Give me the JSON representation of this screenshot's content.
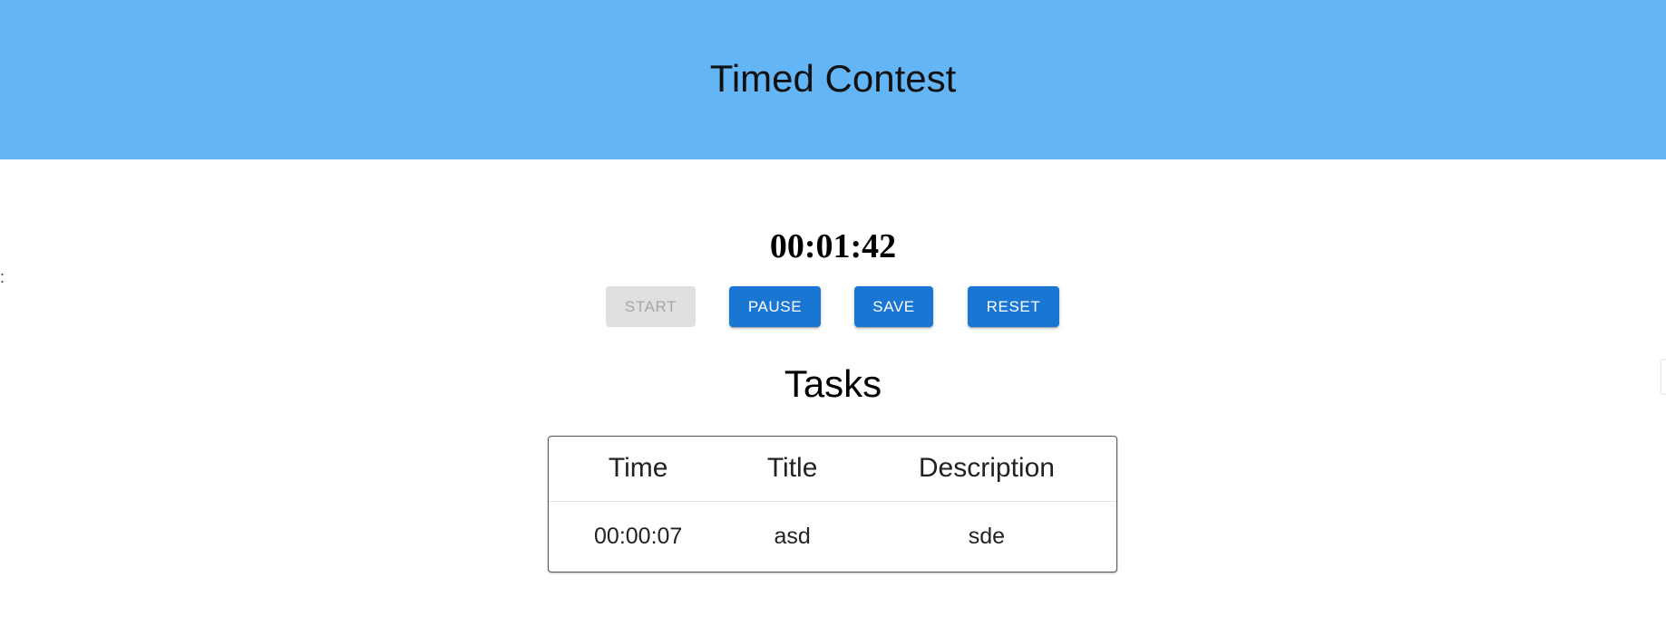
{
  "header": {
    "title": "Timed Contest",
    "background_color": "#64b5f6"
  },
  "timer": {
    "value": "00:01:42"
  },
  "controls": {
    "start_label": "START",
    "pause_label": "PAUSE",
    "save_label": "SAVE",
    "reset_label": "RESET",
    "start_disabled": true,
    "accent_color": "#1976d2"
  },
  "tasks": {
    "heading": "Tasks",
    "columns": [
      "Time",
      "Title",
      "Description"
    ],
    "rows": [
      {
        "time": "00:00:07",
        "title": "asd",
        "description": "sde"
      }
    ]
  },
  "edge": {
    "left_glyph": ":"
  }
}
